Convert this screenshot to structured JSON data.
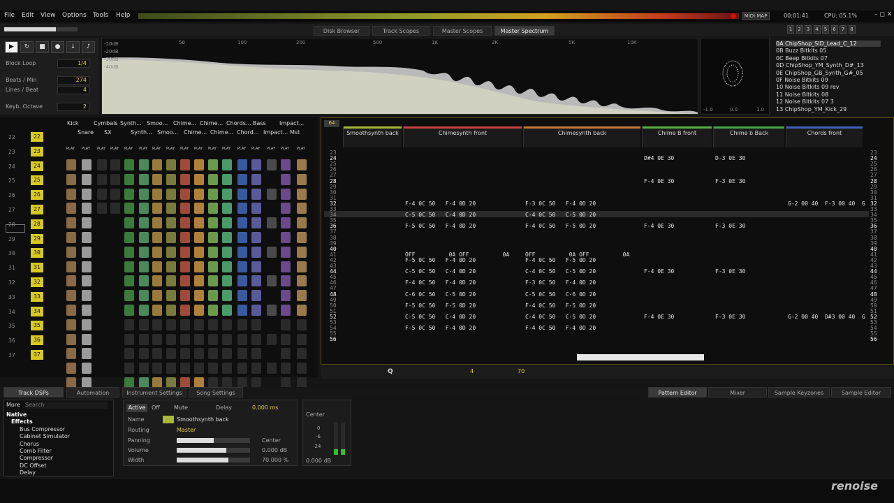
{
  "menu": [
    "File",
    "Edit",
    "View",
    "Options",
    "Tools",
    "Help"
  ],
  "topbar": {
    "midi_map": "MIDI MAP",
    "time": "00:01:41",
    "cpu": "CPU: 05.1%"
  },
  "view_tabs": [
    {
      "label": "Disk Browser",
      "active": false
    },
    {
      "label": "Track Scopes",
      "active": false
    },
    {
      "label": "Master Scopes",
      "active": false
    },
    {
      "label": "Master Spectrum",
      "active": true
    }
  ],
  "layout_buttons": [
    "1",
    "2",
    "3",
    "4",
    "5",
    "6",
    "7",
    "8"
  ],
  "transport": {
    "block_loop_label": "Block Loop",
    "block_loop_value": "1/4",
    "bpm_label": "Beats / Min",
    "bpm": "274",
    "lpb_label": "Lines / Beat",
    "lpb": "4",
    "octave_label": "Keyb. Octave",
    "octave": "2"
  },
  "spectrum": {
    "db_labels": [
      "-10dB",
      "-20dB",
      "-30dB",
      "-40dB"
    ],
    "freq_labels": [
      "50",
      "100",
      "200",
      "500",
      "1K",
      "2K",
      "5K",
      "10K"
    ],
    "scope_labels": [
      "-1.0",
      "0.0",
      "1.0"
    ]
  },
  "instruments": [
    {
      "idx": "0A",
      "name": "ChipShop_SID_Lead_C_12",
      "selected": true
    },
    {
      "idx": "0B",
      "name": "Buzz Bitkits 05",
      "selected": false
    },
    {
      "idx": "0C",
      "name": "Beep Bitkits 07",
      "selected": false
    },
    {
      "idx": "0D",
      "name": "ChipShop_YM_Synth_D#_13",
      "selected": false
    },
    {
      "idx": "0E",
      "name": "ChipShop_GB_Synth_G#_05",
      "selected": false
    },
    {
      "idx": "0F",
      "name": "Noise Bitkits 09",
      "selected": false
    },
    {
      "idx": "10",
      "name": "Noise Bitkits 09 rev",
      "selected": false
    },
    {
      "idx": "11",
      "name": "Noise Bitkits 08",
      "selected": false
    },
    {
      "idx": "12",
      "name": "Noise Bitkits 07 3",
      "selected": false
    },
    {
      "idx": "13",
      "name": "ChipShop_YM_Kick_29",
      "selected": false
    }
  ],
  "matrix": {
    "tracks_row1": [
      "Kick",
      "Cymbals",
      "Synth...",
      "Smoo...",
      "Chime...",
      "Chime...",
      "Chords...",
      "Bass",
      "Impact..."
    ],
    "tracks_row2": [
      "Snare",
      "SX",
      "Synth...",
      "Smoo...",
      "Chime...",
      "Chime...",
      "Chord...",
      "Impact...",
      "Mst"
    ],
    "seq_numbers": [
      "22",
      "23",
      "24",
      "25",
      "26",
      "27",
      "28",
      "29",
      "30",
      "31",
      "32",
      "33",
      "34",
      "35",
      "36",
      "37"
    ],
    "pattern_numbers": [
      "22",
      "23",
      "24",
      "25",
      "26",
      "27",
      "28",
      "29",
      "30",
      "31",
      "32",
      "33",
      "34",
      "35",
      "36",
      "37"
    ],
    "play_label": "PLAY"
  },
  "pattern": {
    "lines_count": "64",
    "tracks": [
      {
        "name": "Smoothsynth back",
        "color": "#a8b838"
      },
      {
        "name": "Chimesynth front",
        "color": "#c84040"
      },
      {
        "name": "Chimesynth back",
        "color": "#c87838"
      },
      {
        "name": "Chime B front",
        "color": "#58b040"
      },
      {
        "name": "Chime b Back",
        "color": "#48a848"
      },
      {
        "name": "Chords front",
        "color": "#4060c0"
      }
    ],
    "row_numbers": [
      "23",
      "24",
      "25",
      "26",
      "27",
      "28",
      "29",
      "30",
      "31",
      "32",
      "33",
      "34",
      "35",
      "36",
      "37",
      "38",
      "39",
      "40",
      "41",
      "42",
      "43",
      "44",
      "45",
      "46",
      "47",
      "48",
      "49",
      "50",
      "51",
      "52",
      "53",
      "54",
      "55",
      "56"
    ],
    "notes": [
      {
        "row": 1,
        "col": 3,
        "text": "D#4 0E 30"
      },
      {
        "row": 1,
        "col": 4,
        "text": "D-3 0E 30"
      },
      {
        "row": 5,
        "col": 3,
        "text": "F-4 0E 30"
      },
      {
        "row": 5,
        "col": 4,
        "text": "F-3 0E 30"
      },
      {
        "row": 9,
        "col": 1,
        "text": "F-4 0C 50   F-4 0D 20"
      },
      {
        "row": 9,
        "col": 2,
        "text": "F-3 0C 50   F-4 0D 20"
      },
      {
        "row": 9,
        "col": 5,
        "text": "G-2 00 40  F-3 00 40  G"
      },
      {
        "row": 11,
        "col": 1,
        "text": "C-5 0C 50   C-4 0D 20"
      },
      {
        "row": 11,
        "col": 2,
        "text": "C-4 0C 50   C-5 0D 20"
      },
      {
        "row": 13,
        "col": 1,
        "text": "F-5 0C 50   F-4 0D 20"
      },
      {
        "row": 13,
        "col": 2,
        "text": "F-4 0C 50   F-5 0D 20"
      },
      {
        "row": 13,
        "col": 3,
        "text": "F-4 0E 30"
      },
      {
        "row": 13,
        "col": 4,
        "text": "F-3 0E 30"
      },
      {
        "row": 18,
        "col": 1,
        "text": "OFF          0A OFF          0A"
      },
      {
        "row": 18,
        "col": 2,
        "text": "OFF          0A OFF          0A"
      },
      {
        "row": 19,
        "col": 1,
        "text": "F-5 0C 50   F-4 0D 20"
      },
      {
        "row": 19,
        "col": 2,
        "text": "F-4 0C 50   F-5 0D 20"
      },
      {
        "row": 21,
        "col": 1,
        "text": "C-5 0C 50   C-4 0D 20"
      },
      {
        "row": 21,
        "col": 2,
        "text": "C-4 0C 50   C-5 0D 20"
      },
      {
        "row": 21,
        "col": 3,
        "text": "F-4 0E 30"
      },
      {
        "row": 21,
        "col": 4,
        "text": "F-3 0E 30"
      },
      {
        "row": 23,
        "col": 1,
        "text": "F-4 0C 50   F-4 0D 20"
      },
      {
        "row": 23,
        "col": 2,
        "text": "F-3 0C 50   F-4 0D 20"
      },
      {
        "row": 25,
        "col": 1,
        "text": "C-6 0C 50   C-5 0D 20"
      },
      {
        "row": 25,
        "col": 2,
        "text": "C-5 0C 50   C-6 0D 20"
      },
      {
        "row": 27,
        "col": 1,
        "text": "F-5 0C 50   F-5 0D 20"
      },
      {
        "row": 27,
        "col": 2,
        "text": "F-4 0C 50   F-5 0D 20"
      },
      {
        "row": 29,
        "col": 1,
        "text": "C-5 0C 50   C-4 0D 20"
      },
      {
        "row": 29,
        "col": 2,
        "text": "C-4 0C 50   C-5 0D 20"
      },
      {
        "row": 29,
        "col": 3,
        "text": "F-4 0E 30"
      },
      {
        "row": 29,
        "col": 4,
        "text": "F-3 0E 30"
      },
      {
        "row": 29,
        "col": 5,
        "text": "G-2 00 40  D#3 00 40  G"
      },
      {
        "row": 31,
        "col": 1,
        "text": "F-5 0C 50   F-4 0D 20"
      },
      {
        "row": 31,
        "col": 2,
        "text": "F-4 0C 50   F-4 0D 20"
      }
    ]
  },
  "pattern_toolbar": {
    "edit_step": "4",
    "octave": "70"
  },
  "lower_tabs_left": [
    {
      "label": "Track DSPs",
      "active": true
    },
    {
      "label": "Automation",
      "active": false
    },
    {
      "label": "Instrument Settings",
      "active": false
    },
    {
      "label": "Song Settings",
      "active": false
    }
  ],
  "lower_tabs_right": [
    {
      "label": "Pattern Editor",
      "active": true
    },
    {
      "label": "Mixer",
      "active": false
    },
    {
      "label": "Sample Keyzones",
      "active": false
    },
    {
      "label": "Sample Editor",
      "active": false
    }
  ],
  "dsp_browser": {
    "more_label": "More",
    "search_placeholder": "Search",
    "native": "Native",
    "effects": "Effects",
    "items": [
      "Bus Compressor",
      "Cabinet Simulator",
      "Chorus",
      "Comb Filter",
      "Compressor",
      "DC Offset",
      "Delay"
    ]
  },
  "track_panel": {
    "active": "Active",
    "off": "Off",
    "mute": "Mute",
    "delay_label": "Delay",
    "delay_value": "0.000 ms",
    "name_label": "Name",
    "name_value": "Smoothsynth back",
    "routing_label": "Routing",
    "routing_value": "Master",
    "panning_label": "Panning",
    "panning_value": "Center",
    "volume_label": "Volume",
    "volume_value": "0.000 dB",
    "width_label": "Width",
    "width_value": "70.000 %"
  },
  "meter": {
    "pan": "Center",
    "scale": [
      "0",
      "-6",
      "-24"
    ],
    "db": "0.000 dB"
  },
  "logo": "renoise"
}
